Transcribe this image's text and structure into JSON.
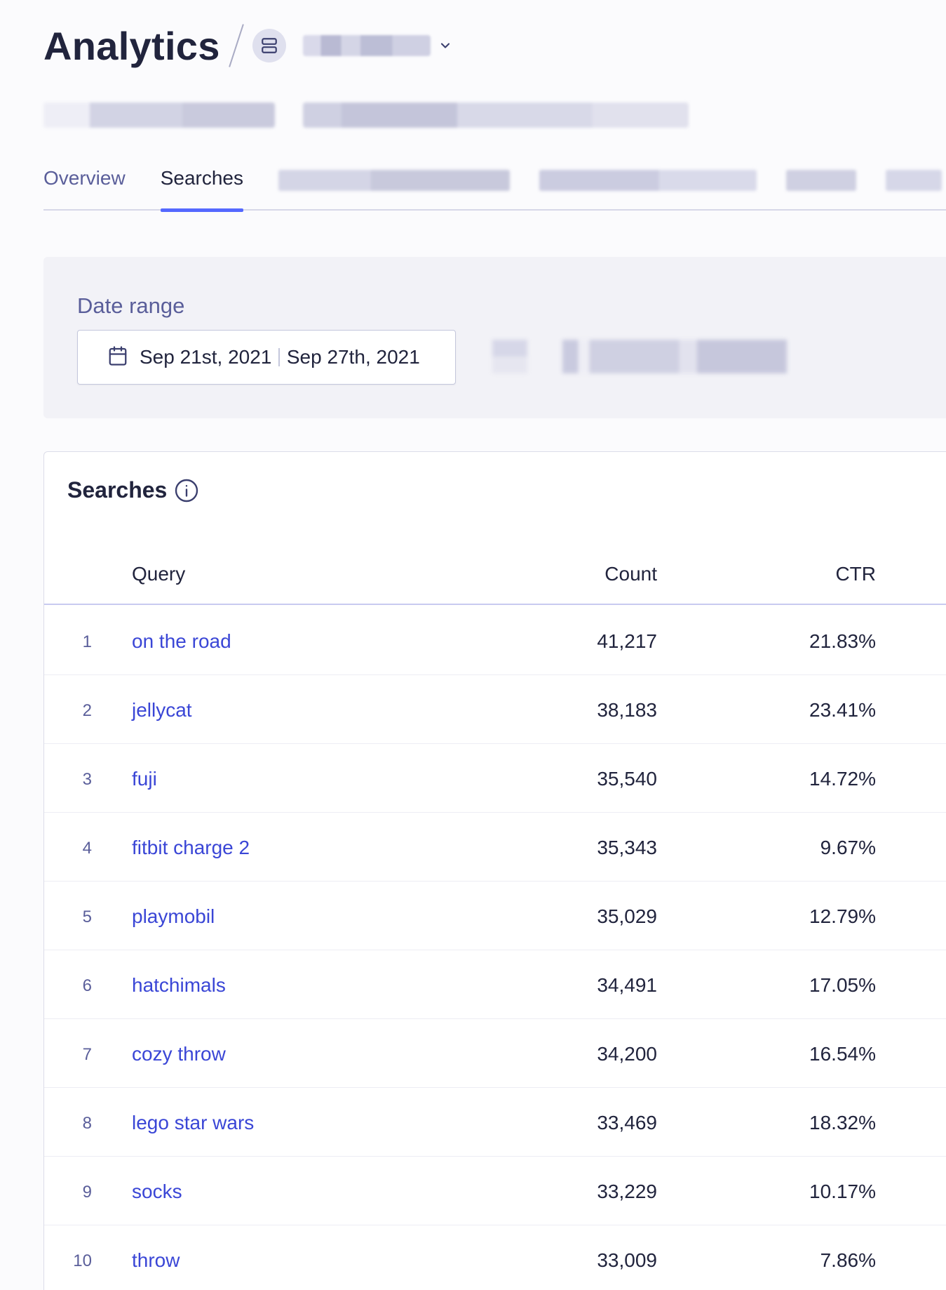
{
  "header": {
    "title": "Analytics",
    "app_icon": "database-icon",
    "dropdown_icon": "chevron-down-icon"
  },
  "tabs": [
    {
      "label": "Overview",
      "active": false
    },
    {
      "label": "Searches",
      "active": true
    }
  ],
  "filters": {
    "date_range_label": "Date range",
    "date_icon": "calendar-icon",
    "start_date": "Sep 21st, 2021",
    "end_date": "Sep 27th, 2021"
  },
  "searches_card": {
    "title": "Searches",
    "info_icon": "info-icon",
    "columns": {
      "query": "Query",
      "count": "Count",
      "ctr": "CTR"
    },
    "rows": [
      {
        "rank": "1",
        "query": "on the road",
        "count": "41,217",
        "ctr": "21.83%"
      },
      {
        "rank": "2",
        "query": "jellycat",
        "count": "38,183",
        "ctr": "23.41%"
      },
      {
        "rank": "3",
        "query": "fuji",
        "count": "35,540",
        "ctr": "14.72%"
      },
      {
        "rank": "4",
        "query": "fitbit charge 2",
        "count": "35,343",
        "ctr": "9.67%"
      },
      {
        "rank": "5",
        "query": "playmobil",
        "count": "35,029",
        "ctr": "12.79%"
      },
      {
        "rank": "6",
        "query": "hatchimals",
        "count": "34,491",
        "ctr": "17.05%"
      },
      {
        "rank": "7",
        "query": "cozy throw",
        "count": "34,200",
        "ctr": "16.54%"
      },
      {
        "rank": "8",
        "query": "lego star wars",
        "count": "33,469",
        "ctr": "18.32%"
      },
      {
        "rank": "9",
        "query": "socks",
        "count": "33,229",
        "ctr": "10.17%"
      },
      {
        "rank": "10",
        "query": "throw",
        "count": "33,009",
        "ctr": "7.86%"
      }
    ]
  },
  "colors": {
    "accent": "#5468ff",
    "link": "#3a46d6",
    "muted_text": "#5a5e9a",
    "text": "#21243d"
  }
}
